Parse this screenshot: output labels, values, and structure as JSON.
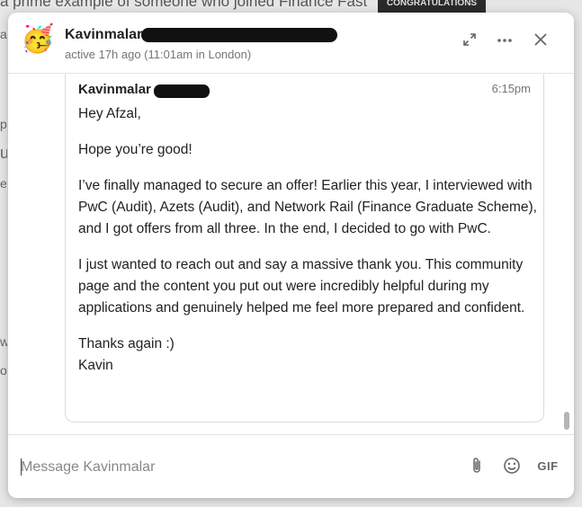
{
  "background": {
    "top_text": "a prime example of someone who joined Finance Fast",
    "banner_text": "CONGRATULATIONS",
    "side_fragments": [
      "a",
      "p",
      "u",
      "ev",
      "o",
      "w"
    ]
  },
  "header": {
    "avatar_icon": "party-face-emoji",
    "avatar_glyph": "🥳",
    "contact_name": "Kavinmalar",
    "status": "active 17h ago (11:01am in London)"
  },
  "message": {
    "sender_name": "Kavinmalar",
    "time": "6:15pm",
    "paragraphs": [
      "Hey Afzal,",
      "Hope you’re good!",
      "I’ve finally managed to secure an offer! Earlier this year, I interviewed with PwC (Audit), Azets (Audit), and Network Rail (Finance Graduate Scheme), and I got offers from all three. In the end, I decided to go with PwC.",
      "I just wanted to reach out and say a massive thank you. This community page and the content you put out were incredibly helpful during my applications and genuinely helped me feel more prepared and confident.",
      "Thanks again :)",
      "Kavin"
    ]
  },
  "composer": {
    "placeholder": "Message Kavinmalar",
    "gif_label": "GIF"
  },
  "colors": {
    "redaction": "#111111",
    "muted_text": "#757575",
    "border": "#dcdcdc"
  }
}
